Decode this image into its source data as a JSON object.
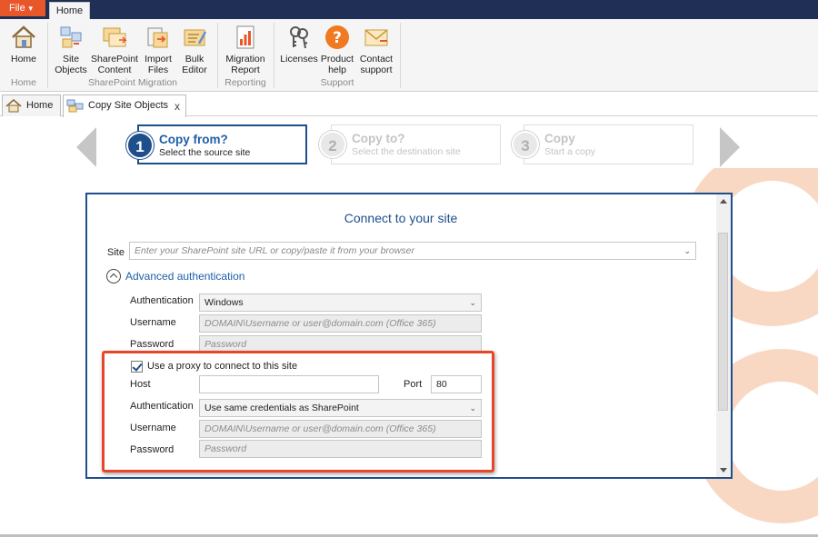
{
  "menu": {
    "file_label": "File",
    "home_tab": "Home"
  },
  "ribbon": {
    "buttons": {
      "home": [
        "Home",
        ""
      ],
      "site_objects": [
        "Site",
        "Objects"
      ],
      "sharepoint_content": [
        "SharePoint",
        "Content"
      ],
      "import_files": [
        "Import",
        "Files"
      ],
      "bulk_editor": [
        "Bulk",
        "Editor"
      ],
      "migration_report": [
        "Migration",
        "Report"
      ],
      "licenses": [
        "Licenses",
        ""
      ],
      "product_help": [
        "Product",
        "help"
      ],
      "contact_support": [
        "Contact",
        "support"
      ]
    },
    "groups": {
      "home": "Home",
      "sharepoint_migration": "SharePoint Migration",
      "reporting": "Reporting",
      "support": "Support"
    }
  },
  "doc_tabs": {
    "home": "Home",
    "copy_site_objects": "Copy Site Objects",
    "close": "x"
  },
  "wizard": {
    "steps": [
      {
        "num": "1",
        "title": "Copy from?",
        "subtitle": "Select the source site"
      },
      {
        "num": "2",
        "title": "Copy to?",
        "subtitle": "Select the destination site"
      },
      {
        "num": "3",
        "title": "Copy",
        "subtitle": "Start a copy"
      }
    ]
  },
  "connect": {
    "title": "Connect to your site",
    "site_label": "Site",
    "site_placeholder": "Enter your SharePoint site URL or copy/paste it from your browser",
    "advanced_auth": "Advanced authentication",
    "auth_label": "Authentication",
    "auth_value": "Windows",
    "username_label": "Username",
    "username_placeholder": "DOMAIN\\Username or user@domain.com (Office 365)",
    "password_label": "Password",
    "password_placeholder": "Password"
  },
  "proxy": {
    "checkbox_label": "Use a proxy to connect to this site",
    "checked": true,
    "host_label": "Host",
    "host_value": "",
    "port_label": "Port",
    "port_value": "80",
    "auth_label": "Authentication",
    "auth_value": "Use same credentials as SharePoint",
    "username_label": "Username",
    "username_placeholder": "DOMAIN\\Username or user@domain.com (Office 365)",
    "password_label": "Password",
    "password_placeholder": "Password"
  },
  "colors": {
    "accent": "#1e4e8c",
    "file": "#e8572a",
    "highlight": "#e8462a",
    "deco": "#f6c7a8"
  }
}
